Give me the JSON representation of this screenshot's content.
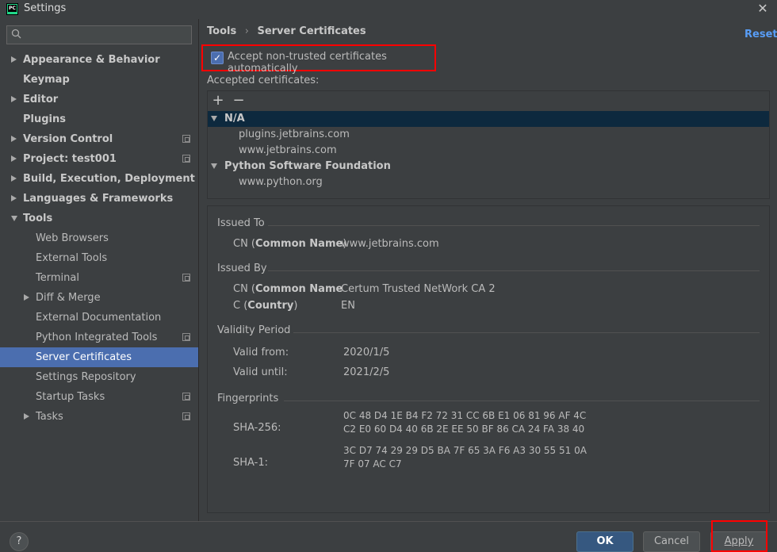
{
  "window": {
    "title": "Settings",
    "app_icon_text": "PC",
    "close_symbol": "✕"
  },
  "search": {
    "placeholder": ""
  },
  "sidebar": {
    "items": [
      {
        "label": "Appearance & Behavior",
        "level": 0,
        "expander": "collapsed",
        "bold": true
      },
      {
        "label": "Keymap",
        "level": 0,
        "expander": "none",
        "bold": true
      },
      {
        "label": "Editor",
        "level": 0,
        "expander": "collapsed",
        "bold": true
      },
      {
        "label": "Plugins",
        "level": 0,
        "expander": "none",
        "bold": true
      },
      {
        "label": "Version Control",
        "level": 0,
        "expander": "collapsed",
        "bold": true,
        "project_icon": true
      },
      {
        "label": "Project: test001",
        "level": 0,
        "expander": "collapsed",
        "bold": true,
        "project_icon": true
      },
      {
        "label": "Build, Execution, Deployment",
        "level": 0,
        "expander": "collapsed",
        "bold": true
      },
      {
        "label": "Languages & Frameworks",
        "level": 0,
        "expander": "collapsed",
        "bold": true
      },
      {
        "label": "Tools",
        "level": 0,
        "expander": "expanded",
        "bold": true
      },
      {
        "label": "Web Browsers",
        "level": 1,
        "expander": "none"
      },
      {
        "label": "External Tools",
        "level": 1,
        "expander": "none"
      },
      {
        "label": "Terminal",
        "level": 1,
        "expander": "none",
        "project_icon": true
      },
      {
        "label": "Diff & Merge",
        "level": 1,
        "expander": "collapsed"
      },
      {
        "label": "External Documentation",
        "level": 1,
        "expander": "none"
      },
      {
        "label": "Python Integrated Tools",
        "level": 1,
        "expander": "none",
        "project_icon": true
      },
      {
        "label": "Server Certificates",
        "level": 1,
        "expander": "none",
        "selected": true
      },
      {
        "label": "Settings Repository",
        "level": 1,
        "expander": "none"
      },
      {
        "label": "Startup Tasks",
        "level": 1,
        "expander": "none",
        "project_icon": true
      },
      {
        "label": "Tasks",
        "level": 1,
        "expander": "collapsed",
        "project_icon": true
      }
    ]
  },
  "header": {
    "breadcrumb_parent": "Tools",
    "breadcrumb_sep": "›",
    "breadcrumb_current": "Server Certificates",
    "reset_label": "Reset"
  },
  "accept": {
    "label": "Accept non-trusted certificates automatically",
    "checked": true,
    "check_mark": "✓"
  },
  "certificates": {
    "heading": "Accepted certificates:",
    "add_symbol": "+",
    "remove_symbol": "−",
    "groups": [
      {
        "name": "N/A",
        "selected": true,
        "children": [
          "plugins.jetbrains.com",
          "www.jetbrains.com"
        ]
      },
      {
        "name": "Python Software Foundation",
        "children": [
          "www.python.org"
        ]
      }
    ]
  },
  "details": {
    "issued_to": {
      "title": "Issued To",
      "cn_prefix": "CN (",
      "cn_bold": "Common Name",
      "cn_suffix": ")",
      "cn_value": "www.jetbrains.com"
    },
    "issued_by": {
      "title": "Issued By",
      "cn_prefix": "CN (",
      "cn_bold": "Common Name",
      "cn_suffix": "",
      "cn_value": "Certum Trusted NetWork CA 2",
      "c_prefix": "C (",
      "c_bold": "Country",
      "c_suffix": ")",
      "c_value": "EN"
    },
    "validity": {
      "title": "Validity Period",
      "from_label": "Valid from:",
      "from_value": "2020/1/5",
      "until_label": "Valid until:",
      "until_value": "2021/2/5"
    },
    "fingerprints": {
      "title": "Fingerprints",
      "sha256_label": "SHA-256:",
      "sha256_line1": "0C 48 D4 1E B4 F2 72 31 CC 6B E1 06 81 96 AF 4C",
      "sha256_line2": "C2 E0 60 D4 40 6B 2E EE 50 BF 86 CA 24 FA 38 40",
      "sha1_label": "SHA-1:",
      "sha1_line1": "3C D7 74 29 29 D5 BA 7F 65 3A F6 A3 30 55 51 0A",
      "sha1_line2": "7F 07 AC C7"
    }
  },
  "footer": {
    "help_label": "?",
    "ok_label": "OK",
    "cancel_label": "Cancel",
    "apply_label": "Apply"
  },
  "colors": {
    "background": "#3c3f41",
    "selection": "#4b6eaf",
    "link": "#589df6",
    "highlight": "#ff0000",
    "ok_button": "#365880"
  }
}
